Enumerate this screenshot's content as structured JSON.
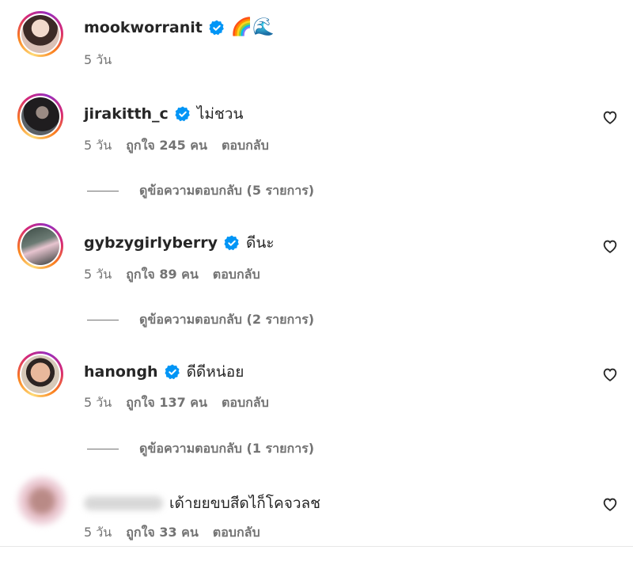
{
  "caption": {
    "username": "mookworranit",
    "emojis": "🌈🌊",
    "time": "5 วัน",
    "verified": true
  },
  "comments": [
    {
      "username": "jirakitth_c",
      "text": "ไม่ชวน",
      "time": "5 วัน",
      "likes": "ถูกใจ 245 คน",
      "reply_label": "ตอบกลับ",
      "view_replies": "ดูข้อความตอบกลับ (5 รายการ)",
      "verified": true
    },
    {
      "username": "gybzygirlyberry",
      "text": "ดีนะ",
      "time": "5 วัน",
      "likes": "ถูกใจ 89 คน",
      "reply_label": "ตอบกลับ",
      "view_replies": "ดูข้อความตอบกลับ (2 รายการ)",
      "verified": true
    },
    {
      "username": "hanongh",
      "text": "ดีดีหน่อย",
      "time": "5 วัน",
      "likes": "ถูกใจ 137 คน",
      "reply_label": "ตอบกลับ",
      "view_replies": "ดูข้อความตอบกลับ (1 รายการ)",
      "verified": true
    },
    {
      "username": "",
      "text": "เด้ายยขบสีดไก็โคจวลช",
      "time": "5 วัน",
      "likes": "ถูกใจ 33 คน",
      "reply_label": "ตอบกลับ",
      "verified": false
    }
  ],
  "colors": {
    "verified_blue": "#0095f6",
    "meta_gray": "#737373",
    "text": "#262626"
  },
  "icons": {
    "verified": "verified-badge-icon",
    "like": "heart-outline-icon"
  }
}
